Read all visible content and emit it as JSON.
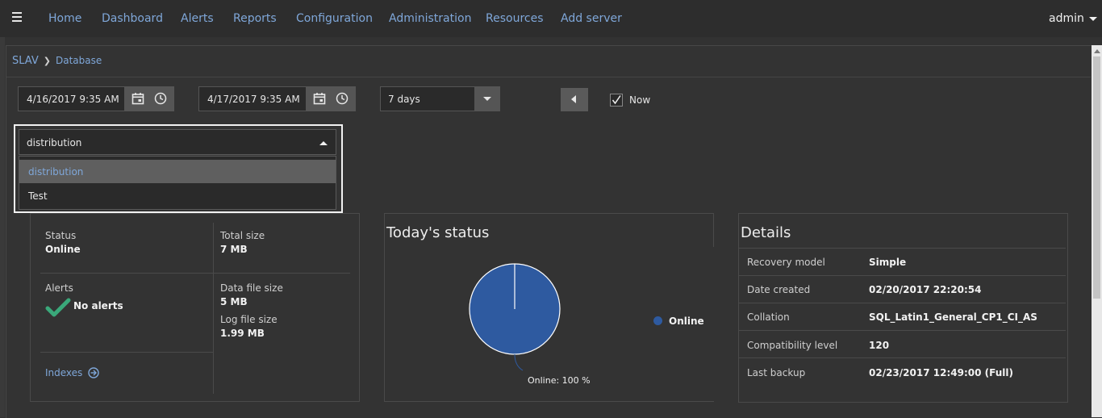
{
  "nav": {
    "items": [
      "Home",
      "Dashboard",
      "Alerts",
      "Reports",
      "Configuration",
      "Administration",
      "Resources",
      "Add server"
    ],
    "user": "admin"
  },
  "breadcrumb": {
    "root": "SLAV",
    "current": "Database"
  },
  "filters": {
    "start_date": "4/16/2017 9:35 AM",
    "end_date": "4/17/2017 9:35 AM",
    "range": "7 days",
    "now_label": "Now",
    "now_checked": true
  },
  "db_dropdown": {
    "selected": "distribution",
    "options": [
      "distribution",
      "Test"
    ]
  },
  "summary": {
    "status_label": "Status",
    "status_value": "Online",
    "total_size_label": "Total size",
    "total_size_value": "7 MB",
    "alerts_label": "Alerts",
    "alerts_value": "No alerts",
    "data_file_label": "Data file size",
    "data_file_value": "5 MB",
    "log_file_label": "Log file size",
    "log_file_value": "1.99 MB",
    "indexes_link": "Indexes"
  },
  "today": {
    "title": "Today's status",
    "slice_label": "Online: 100 %",
    "legend": "Online",
    "color": "#2e5aa0"
  },
  "chart_data": {
    "type": "pie",
    "title": "Today's status",
    "slices": [
      {
        "name": "Online",
        "value": 100
      }
    ]
  },
  "details": {
    "title": "Details",
    "rows": [
      {
        "label": "Recovery model",
        "value": "Simple"
      },
      {
        "label": "Date created",
        "value": "02/20/2017 22:20:54"
      },
      {
        "label": "Collation",
        "value": "SQL_Latin1_General_CP1_CI_AS"
      },
      {
        "label": "Compatibility level",
        "value": "120"
      },
      {
        "label": "Last backup",
        "value": "02/23/2017 12:49:00 (Full)"
      }
    ]
  }
}
